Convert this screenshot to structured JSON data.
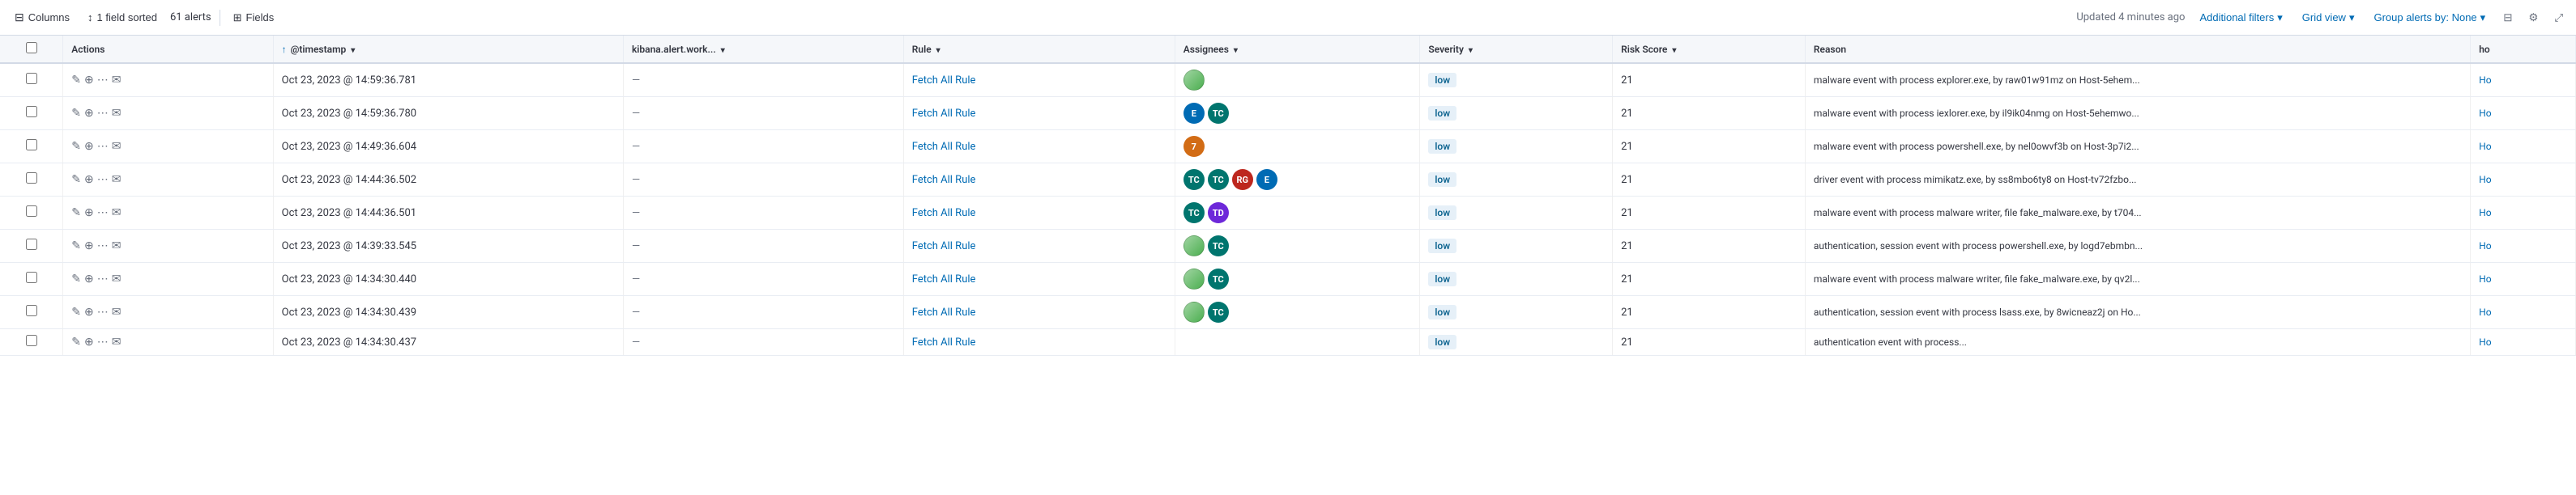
{
  "toolbar": {
    "columns_label": "Columns",
    "sort_label": "1 field sorted",
    "alerts_label": "61 alerts",
    "fields_label": "Fields",
    "updated_text": "Updated 4 minutes ago",
    "additional_filters_label": "Additional filters",
    "grid_view_label": "Grid view",
    "group_alerts_label": "Group alerts by: None"
  },
  "table": {
    "columns": [
      {
        "id": "checkbox",
        "label": ""
      },
      {
        "id": "actions",
        "label": "Actions"
      },
      {
        "id": "timestamp",
        "label": "@timestamp",
        "sortable": true
      },
      {
        "id": "kibana",
        "label": "kibana.alert.work..."
      },
      {
        "id": "rule",
        "label": "Rule"
      },
      {
        "id": "assignees",
        "label": "Assignees"
      },
      {
        "id": "severity",
        "label": "Severity"
      },
      {
        "id": "riskscore",
        "label": "Risk Score"
      },
      {
        "id": "reason",
        "label": "Reason"
      },
      {
        "id": "hc",
        "label": "ho"
      }
    ],
    "rows": [
      {
        "timestamp": "Oct 23, 2023 @ 14:59:36.781",
        "kibana": "—",
        "rule": "Fetch All Rule",
        "assignees": [
          {
            "type": "img",
            "color": "av-green",
            "label": ""
          }
        ],
        "severity": "low",
        "riskscore": "21",
        "reason": "malware event with process explorer.exe, by raw01w91mz on Host-5ehem...",
        "hc": "Ho"
      },
      {
        "timestamp": "Oct 23, 2023 @ 14:59:36.780",
        "kibana": "—",
        "rule": "Fetch All Rule",
        "assignees": [
          {
            "type": "text",
            "color": "av-blue",
            "label": "E"
          },
          {
            "type": "text",
            "color": "av-teal",
            "label": "TC"
          }
        ],
        "severity": "low",
        "riskscore": "21",
        "reason": "malware event with process iexlorer.exe, by il9ik04nmg on Host-5ehemwo...",
        "hc": "Ho"
      },
      {
        "timestamp": "Oct 23, 2023 @ 14:49:36.604",
        "kibana": "—",
        "rule": "Fetch All Rule",
        "assignees": [
          {
            "type": "text",
            "color": "av-orange",
            "label": "7"
          }
        ],
        "severity": "low",
        "riskscore": "21",
        "reason": "malware event with process powershell.exe, by nel0owvf3b on Host-3p7i2...",
        "hc": "Ho"
      },
      {
        "timestamp": "Oct 23, 2023 @ 14:44:36.502",
        "kibana": "—",
        "rule": "Fetch All Rule",
        "assignees": [
          {
            "type": "text",
            "color": "av-teal",
            "label": "TC"
          },
          {
            "type": "text",
            "color": "av-teal",
            "label": "TC"
          },
          {
            "type": "text",
            "color": "av-red",
            "label": "RG"
          },
          {
            "type": "text",
            "color": "av-blue",
            "label": "E"
          }
        ],
        "severity": "low",
        "riskscore": "21",
        "reason": "driver event with process mimikatz.exe, by ss8mbo6ty8 on Host-tv72fzbo...",
        "hc": "Ho"
      },
      {
        "timestamp": "Oct 23, 2023 @ 14:44:36.501",
        "kibana": "—",
        "rule": "Fetch All Rule",
        "assignees": [
          {
            "type": "text",
            "color": "av-teal",
            "label": "TC"
          },
          {
            "type": "text",
            "color": "av-purple",
            "label": "TD"
          }
        ],
        "severity": "low",
        "riskscore": "21",
        "reason": "malware event with process malware writer, file fake_malware.exe, by t704...",
        "hc": "Ho"
      },
      {
        "timestamp": "Oct 23, 2023 @ 14:39:33.545",
        "kibana": "—",
        "rule": "Fetch All Rule",
        "assignees": [
          {
            "type": "img",
            "color": "av-green",
            "label": ""
          },
          {
            "type": "text",
            "color": "av-teal",
            "label": "TC"
          }
        ],
        "severity": "low",
        "riskscore": "21",
        "reason": "authentication, session event with process powershell.exe, by logd7ebmbn...",
        "hc": "Ho"
      },
      {
        "timestamp": "Oct 23, 2023 @ 14:34:30.440",
        "kibana": "—",
        "rule": "Fetch All Rule",
        "assignees": [
          {
            "type": "img",
            "color": "av-green",
            "label": ""
          },
          {
            "type": "text",
            "color": "av-teal",
            "label": "TC"
          }
        ],
        "severity": "low",
        "riskscore": "21",
        "reason": "malware event with process malware writer, file fake_malware.exe, by qv2l...",
        "hc": "Ho"
      },
      {
        "timestamp": "Oct 23, 2023 @ 14:34:30.439",
        "kibana": "—",
        "rule": "Fetch All Rule",
        "assignees": [
          {
            "type": "img",
            "color": "av-green",
            "label": ""
          },
          {
            "type": "text",
            "color": "av-teal",
            "label": "TC"
          }
        ],
        "severity": "low",
        "riskscore": "21",
        "reason": "authentication, session event with process lsass.exe, by 8wicneaz2j on Ho...",
        "hc": "Ho"
      },
      {
        "timestamp": "Oct 23, 2023 @ 14:34:30.437",
        "kibana": "—",
        "rule": "Fetch All Rule",
        "assignees": [],
        "severity": "low",
        "riskscore": "21",
        "reason": "authentication event with process...",
        "hc": "Ho"
      }
    ]
  }
}
